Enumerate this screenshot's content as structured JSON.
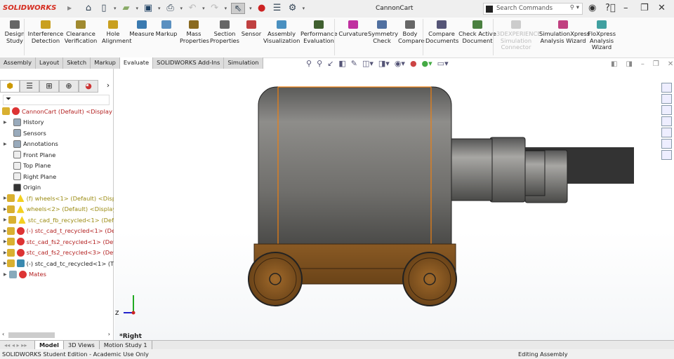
{
  "app": {
    "logo": "SOLIDWORKS",
    "document_title": "CannonCart",
    "search_placeholder": "Search Commands"
  },
  "ribbon": [
    {
      "label": "Design Study",
      "color": "#666"
    },
    {
      "label": "Interference Detection",
      "color": "#c9a020"
    },
    {
      "label": "Clearance Verification",
      "color": "#a08a30"
    },
    {
      "label": "Hole Alignment",
      "color": "#c9a020"
    },
    {
      "label": "Measure",
      "color": "#3a7ab0"
    },
    {
      "label": "Markup",
      "color": "#5a90c0"
    },
    {
      "label": "Mass Properties",
      "color": "#8a6a20"
    },
    {
      "label": "Section Properties",
      "color": "#666"
    },
    {
      "label": "Sensor",
      "color": "#c04040"
    },
    {
      "label": "Assembly Visualization",
      "color": "#4a90c0"
    },
    {
      "label": "Performance Evaluation",
      "color": "#406030"
    },
    {
      "label": "Curvature",
      "color": "#c030a0"
    },
    {
      "label": "Symmetry Check",
      "color": "#5070a0"
    },
    {
      "label": "Body Compare",
      "color": "#666"
    },
    {
      "label": "Compare Documents",
      "color": "#557"
    },
    {
      "label": "Check Active Document",
      "color": "#4a8040"
    },
    {
      "label": "3DEXPERIENCE Simulation Connector",
      "color": "#ccc"
    },
    {
      "label": "SimulationXpress Analysis Wizard",
      "color": "#c04080"
    },
    {
      "label": "FloXpress Analysis Wizard",
      "color": "#40a0a0"
    }
  ],
  "tabs": [
    "Assembly",
    "Layout",
    "Sketch",
    "Markup",
    "Evaluate",
    "SOLIDWORKS Add-Ins",
    "Simulation"
  ],
  "tree": {
    "root": "CannonCart (Default) <Display St",
    "items": [
      {
        "label": "History",
        "style": ""
      },
      {
        "label": "Sensors",
        "style": ""
      },
      {
        "label": "Annotations",
        "style": ""
      },
      {
        "label": "Front Plane",
        "style": ""
      },
      {
        "label": "Top Plane",
        "style": ""
      },
      {
        "label": "Right Plane",
        "style": ""
      },
      {
        "label": "Origin",
        "style": ""
      },
      {
        "label": "(f) wheels<1> (Default) <Disp",
        "style": "olive"
      },
      {
        "label": "wheels<2> (Default) <Display",
        "style": "olive"
      },
      {
        "label": "stc_cad_fb_recycled<1> (Def",
        "style": "olive"
      },
      {
        "label": "(-) stc_cad_t_recycled<1> (De",
        "style": "red"
      },
      {
        "label": "stc_cad_fs2_recycled<1> (Def",
        "style": "red"
      },
      {
        "label": "stc_cad_fs2_recycled<3> (Def",
        "style": "red"
      },
      {
        "label": "(-) stc_cad_tc_recycled<1> (T",
        "style": ""
      },
      {
        "label": "Mates",
        "style": "red"
      }
    ]
  },
  "viewport": {
    "view_label": "*Right",
    "triad_z": "Z"
  },
  "bottom_tabs": [
    "Model",
    "3D Views",
    "Motion Study 1"
  ],
  "status": {
    "left": "SOLIDWORKS Student Edition - Academic Use Only",
    "right": "Editing Assembly"
  }
}
